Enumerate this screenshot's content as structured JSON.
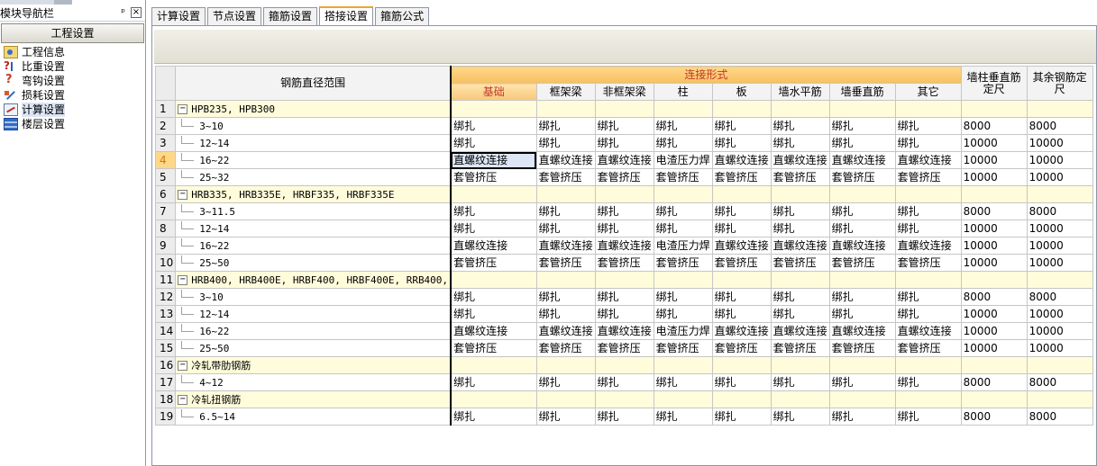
{
  "nav": {
    "title": "模块导航栏",
    "pin": "ᵖ",
    "close": "×",
    "group": "工程设置",
    "items": [
      {
        "label": "工程信息",
        "icon": "project-info-icon"
      },
      {
        "label": "比重设置",
        "icon": "density-icon"
      },
      {
        "label": "弯钩设置",
        "icon": "hook-icon"
      },
      {
        "label": "损耗设置",
        "icon": "loss-icon"
      },
      {
        "label": "计算设置",
        "icon": "calc-icon",
        "selected": true
      },
      {
        "label": "楼层设置",
        "icon": "floor-icon"
      }
    ]
  },
  "tabs": [
    {
      "label": "计算设置"
    },
    {
      "label": "节点设置"
    },
    {
      "label": "箍筋设置"
    },
    {
      "label": "搭接设置",
      "active": true
    },
    {
      "label": "箍筋公式"
    }
  ],
  "grid": {
    "header": {
      "range": "钢筋直径范围",
      "connection_group": "连接形式",
      "sub": [
        "基础",
        "框架梁",
        "非框架梁",
        "柱",
        "板",
        "墙水平筋",
        "墙垂直筋",
        "其它"
      ],
      "wall_vertical_len": "墙柱垂直筋定尺",
      "other_len": "其余钢筋定尺"
    },
    "rows": [
      {
        "n": "1",
        "group": "HPB235, HPB300"
      },
      {
        "n": "2",
        "range": "3~10",
        "cells": [
          "绑扎",
          "绑扎",
          "绑扎",
          "绑扎",
          "绑扎",
          "绑扎",
          "绑扎",
          "绑扎",
          "8000",
          "8000"
        ]
      },
      {
        "n": "3",
        "range": "12~14",
        "cells": [
          "绑扎",
          "绑扎",
          "绑扎",
          "绑扎",
          "绑扎",
          "绑扎",
          "绑扎",
          "绑扎",
          "10000",
          "10000"
        ]
      },
      {
        "n": "4",
        "range": "16~22",
        "highlight": true,
        "cells": [
          "直螺纹连接",
          "直螺纹连接",
          "直螺纹连接",
          "电渣压力焊",
          "直螺纹连接",
          "直螺纹连接",
          "直螺纹连接",
          "直螺纹连接",
          "10000",
          "10000"
        ]
      },
      {
        "n": "5",
        "range": "25~32",
        "cells": [
          "套管挤压",
          "套管挤压",
          "套管挤压",
          "套管挤压",
          "套管挤压",
          "套管挤压",
          "套管挤压",
          "套管挤压",
          "10000",
          "10000"
        ]
      },
      {
        "n": "6",
        "group": "HRB335, HRB335E, HRBF335, HRBF335E"
      },
      {
        "n": "7",
        "range": "3~11.5",
        "cells": [
          "绑扎",
          "绑扎",
          "绑扎",
          "绑扎",
          "绑扎",
          "绑扎",
          "绑扎",
          "绑扎",
          "8000",
          "8000"
        ]
      },
      {
        "n": "8",
        "range": "12~14",
        "cells": [
          "绑扎",
          "绑扎",
          "绑扎",
          "绑扎",
          "绑扎",
          "绑扎",
          "绑扎",
          "绑扎",
          "10000",
          "10000"
        ]
      },
      {
        "n": "9",
        "range": "16~22",
        "cells": [
          "直螺纹连接",
          "直螺纹连接",
          "直螺纹连接",
          "电渣压力焊",
          "直螺纹连接",
          "直螺纹连接",
          "直螺纹连接",
          "直螺纹连接",
          "10000",
          "10000"
        ]
      },
      {
        "n": "10",
        "range": "25~50",
        "cells": [
          "套管挤压",
          "套管挤压",
          "套管挤压",
          "套管挤压",
          "套管挤压",
          "套管挤压",
          "套管挤压",
          "套管挤压",
          "10000",
          "10000"
        ]
      },
      {
        "n": "11",
        "group": "HRB400, HRB400E, HRBF400, HRBF400E, RRB400,"
      },
      {
        "n": "12",
        "range": "3~10",
        "cells": [
          "绑扎",
          "绑扎",
          "绑扎",
          "绑扎",
          "绑扎",
          "绑扎",
          "绑扎",
          "绑扎",
          "8000",
          "8000"
        ]
      },
      {
        "n": "13",
        "range": "12~14",
        "cells": [
          "绑扎",
          "绑扎",
          "绑扎",
          "绑扎",
          "绑扎",
          "绑扎",
          "绑扎",
          "绑扎",
          "10000",
          "10000"
        ]
      },
      {
        "n": "14",
        "range": "16~22",
        "cells": [
          "直螺纹连接",
          "直螺纹连接",
          "直螺纹连接",
          "电渣压力焊",
          "直螺纹连接",
          "直螺纹连接",
          "直螺纹连接",
          "直螺纹连接",
          "10000",
          "10000"
        ]
      },
      {
        "n": "15",
        "range": "25~50",
        "cells": [
          "套管挤压",
          "套管挤压",
          "套管挤压",
          "套管挤压",
          "套管挤压",
          "套管挤压",
          "套管挤压",
          "套管挤压",
          "10000",
          "10000"
        ]
      },
      {
        "n": "16",
        "group": "冷轧带肋钢筋"
      },
      {
        "n": "17",
        "range": "4~12",
        "cells": [
          "绑扎",
          "绑扎",
          "绑扎",
          "绑扎",
          "绑扎",
          "绑扎",
          "绑扎",
          "绑扎",
          "8000",
          "8000"
        ]
      },
      {
        "n": "18",
        "group": "冷轧扭钢筋"
      },
      {
        "n": "19",
        "range": "6.5~14",
        "cells": [
          "绑扎",
          "绑扎",
          "绑扎",
          "绑扎",
          "绑扎",
          "绑扎",
          "绑扎",
          "绑扎",
          "8000",
          "8000"
        ]
      }
    ]
  }
}
